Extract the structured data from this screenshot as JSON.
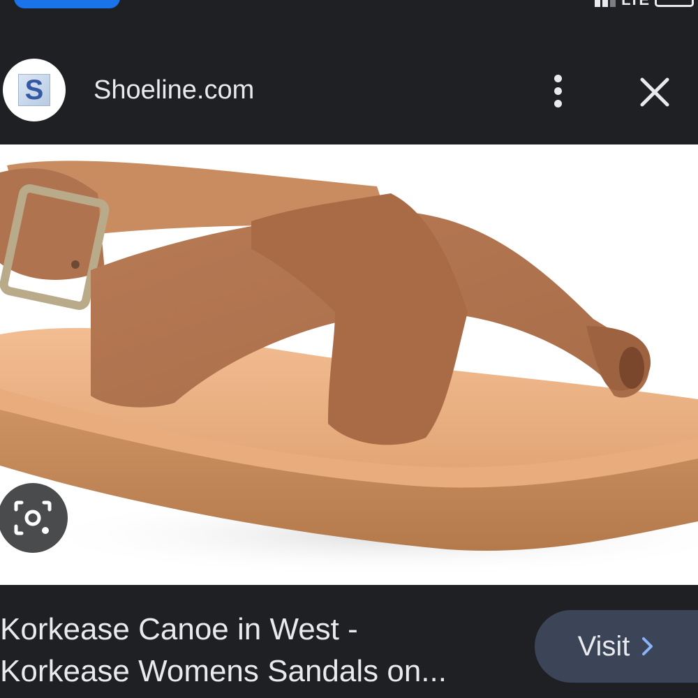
{
  "status_bar": {
    "network": "LTE"
  },
  "header": {
    "logo_letter": "S",
    "site_name": "Shoeline.com",
    "more_icon": "more-vert-icon",
    "close_icon": "close-icon"
  },
  "image": {
    "subject": "tan leather crisscross toe-loop sandal with buckle strap"
  },
  "lens_icon": "camera-search-icon",
  "caption": {
    "line1": "Korkease Canoe in West -",
    "line2": "Korkease Womens Sandals on..."
  },
  "visit": {
    "label": "Visit",
    "icon": "chevron-right-icon"
  },
  "colors": {
    "background": "#1f2023",
    "accent": "#8ab4f8",
    "visit_bg": "#3b4557"
  }
}
